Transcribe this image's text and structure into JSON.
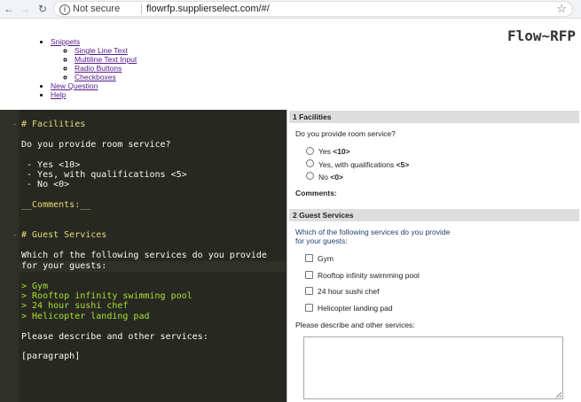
{
  "browser": {
    "secure_label": "Not secure",
    "url": "flowrfp.supplierselect.com/#/"
  },
  "app": {
    "logo": "Flow~RFP"
  },
  "menu": {
    "snippets": "Snippets",
    "snippet_items": [
      "Single Line Text",
      "Multiline Text Input",
      "Radio Buttons",
      "Checkboxes"
    ],
    "new_question": "New Question",
    "help": "Help"
  },
  "editor": {
    "lines": [
      {
        "text": "# Facilities",
        "style": "heading"
      },
      {
        "text": "",
        "style": "plain"
      },
      {
        "text": "Do you provide room service?",
        "style": "plain"
      },
      {
        "text": "",
        "style": "plain"
      },
      {
        "text": " - Yes <10>",
        "style": "plain"
      },
      {
        "text": " - Yes, with qualifications <5>",
        "style": "plain"
      },
      {
        "text": " - No <0>",
        "style": "plain"
      },
      {
        "text": "",
        "style": "plain"
      },
      {
        "text": "__Comments:__",
        "style": "heading"
      },
      {
        "text": "",
        "style": "plain"
      },
      {
        "text": "",
        "style": "plain"
      },
      {
        "text": "# Guest Services",
        "style": "heading"
      },
      {
        "text": "",
        "style": "plain"
      },
      {
        "text": "Which of the following services do you provide",
        "style": "plain"
      },
      {
        "text": "for your guests:",
        "style": "plain"
      },
      {
        "text": "",
        "style": "plain"
      },
      {
        "text": "> Gym",
        "style": "quote"
      },
      {
        "text": "> Rooftop infinity swimming pool",
        "style": "quote"
      },
      {
        "text": "> 24 hour sushi chef",
        "style": "quote"
      },
      {
        "text": "> Helicopter landing pad",
        "style": "quote"
      },
      {
        "text": "",
        "style": "plain"
      },
      {
        "text": "Please describe and other services:",
        "style": "plain"
      },
      {
        "text": "",
        "style": "plain"
      },
      {
        "text": "[paragraph]",
        "style": "plain"
      }
    ]
  },
  "preview": {
    "section1": {
      "title": "1 Facilities",
      "question": "Do you provide room service?",
      "options": [
        {
          "label": "Yes ",
          "score": "<10>"
        },
        {
          "label": "Yes, with qualifications ",
          "score": "<5>"
        },
        {
          "label": "No ",
          "score": "<0>"
        }
      ],
      "comments_label": "Comments:"
    },
    "section2": {
      "title": "2 Guest Services",
      "question_line1": "Which of the following services do you provide",
      "question_line2": "for your guests:",
      "options": [
        "Gym",
        "Rooftop infinity swimming pool",
        "24 hour sushi chef",
        "Helicopter landing pad"
      ],
      "describe_label": "Please describe and other services:"
    }
  }
}
